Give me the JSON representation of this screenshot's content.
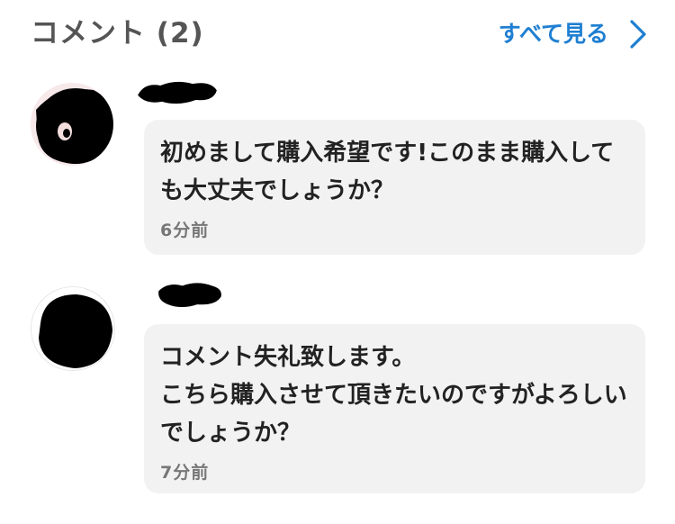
{
  "header": {
    "title": "コメント (2)",
    "see_all_label": "すべて見る",
    "see_all_icon": "chevron-right-icon",
    "accent_color": "#1f7fd1"
  },
  "comments": [
    {
      "text": "初めまして購入希望です!このまま購入しても大丈夫でしょうか？",
      "time": "6分前"
    },
    {
      "text": "コメント失礼致します。\nこちら購入させて頂きたいのですがよろしいでしょうか？",
      "time": "7分前"
    }
  ]
}
